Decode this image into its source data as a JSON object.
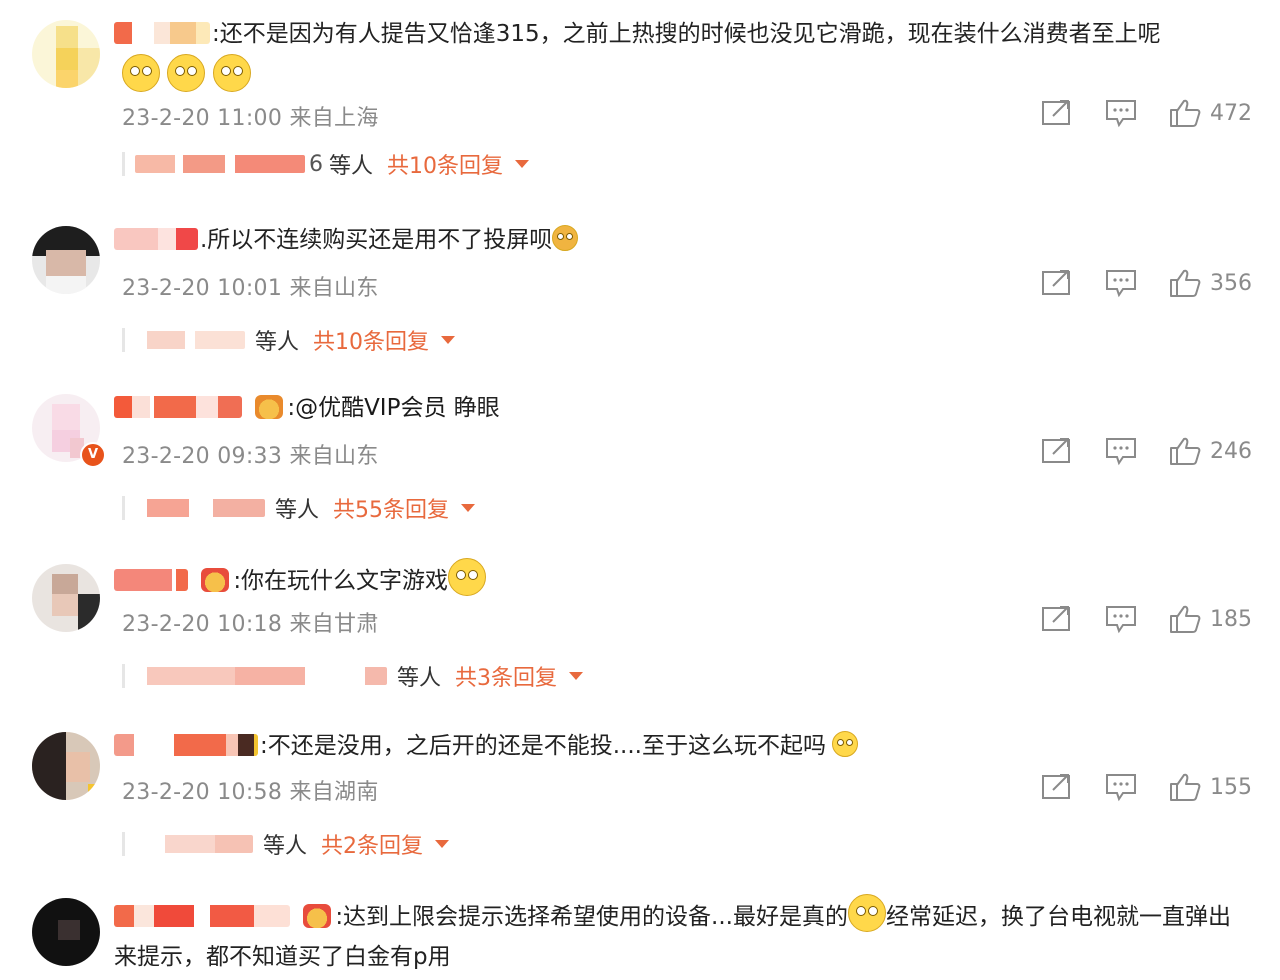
{
  "icons": {
    "share": "share-icon",
    "comment": "comment-icon",
    "like": "like-icon",
    "expand": "caret-down-icon"
  },
  "colors": {
    "accent": "#e8693d",
    "meta": "#8a8a8a"
  },
  "comments": [
    {
      "text": ":还不是因为有人提告又恰逢315，之前上热搜的时候也没见它滑跪，现在装什么消费者至上呢",
      "meta": "23-2-20 11:00 来自上海",
      "likes": "472",
      "replies": {
        "names_tail": "6",
        "deng": "等人",
        "total": "共10条回复"
      }
    },
    {
      "text": ".所以不连续购买还是用不了投屏呗",
      "meta": "23-2-20 10:01 来自山东",
      "likes": "356",
      "replies": {
        "names_tail": "",
        "deng": "等人",
        "total": "共10条回复"
      }
    },
    {
      "text_pre": ":",
      "mention": "@优酷VIP会员",
      "text_post": " 睁眼",
      "meta": "23-2-20 09:33 来自山东",
      "likes": "246",
      "replies": {
        "names_tail": "",
        "deng": "等人",
        "total": "共55条回复"
      }
    },
    {
      "text": ":你在玩什么文字游戏",
      "meta": "23-2-20 10:18 来自甘肃",
      "likes": "185",
      "replies": {
        "names_tail": "",
        "deng": "等人",
        "total": "共3条回复"
      }
    },
    {
      "text": ":不还是没用，之后开的还是不能投....至于这么玩不起吗",
      "meta": "23-2-20 10:58 来自湖南",
      "likes": "155",
      "replies": {
        "names_tail": "",
        "deng": "等人",
        "total": "共2条回复"
      }
    },
    {
      "text_a": ":达到上限会提示选择希望使用的设备...最好是真的",
      "text_b": "经常延迟，换了台电视就一直弹出来提示，都不知道买了白金有p用"
    }
  ]
}
